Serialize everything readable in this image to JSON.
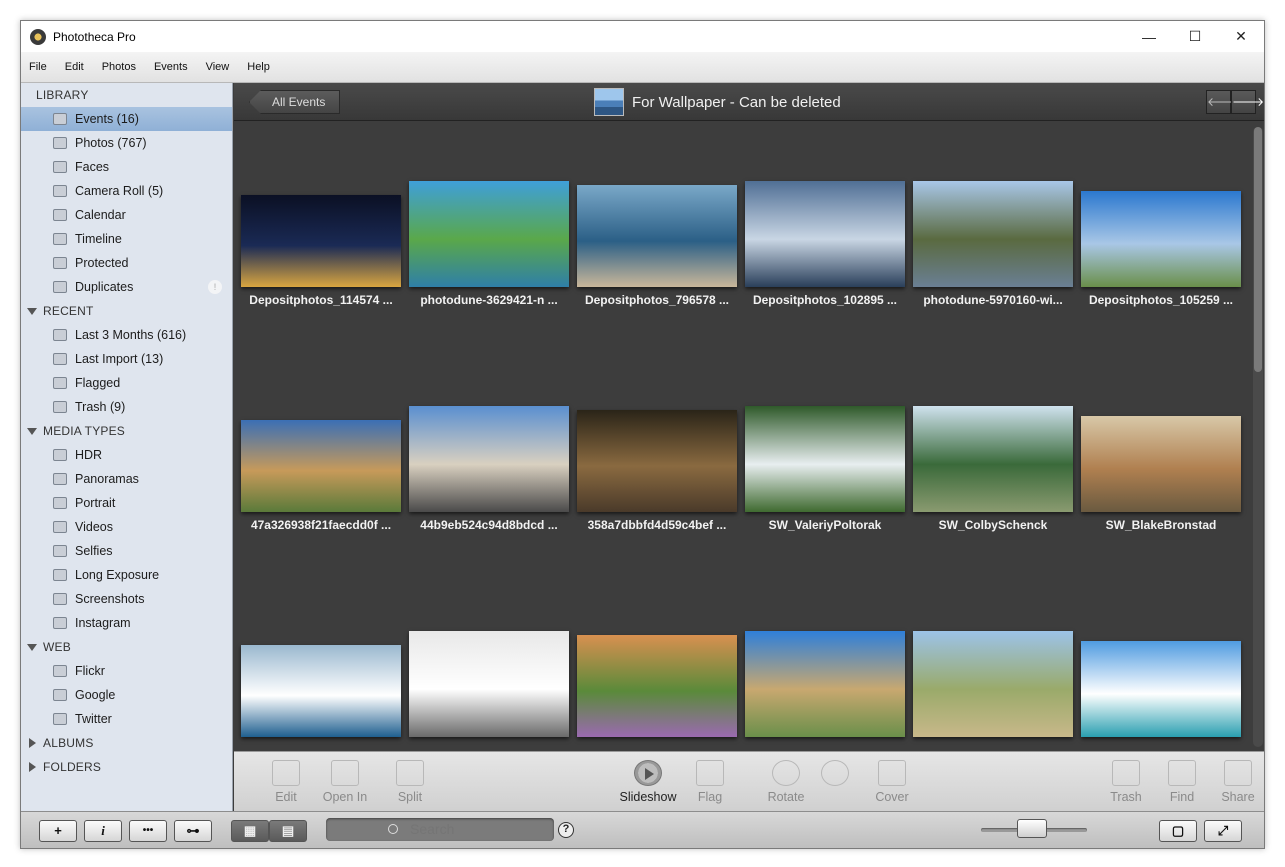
{
  "window": {
    "title": "Phototheca Pro",
    "controls": [
      "—",
      "☐",
      "✕"
    ]
  },
  "menu": [
    "File",
    "Edit",
    "Photos",
    "Events",
    "View",
    "Help"
  ],
  "sidebar": {
    "library_label": "LIBRARY",
    "library": [
      {
        "label": "Events (16)",
        "icon": "events-icon",
        "selected": true
      },
      {
        "label": "Photos (767)",
        "icon": "photos-icon"
      },
      {
        "label": "Faces",
        "icon": "faces-icon"
      },
      {
        "label": "Camera Roll (5)",
        "icon": "camera-roll-icon"
      },
      {
        "label": "Calendar",
        "icon": "calendar-icon"
      },
      {
        "label": "Timeline",
        "icon": "timeline-icon"
      },
      {
        "label": "Protected",
        "icon": "lock-icon"
      },
      {
        "label": "Duplicates",
        "icon": "duplicates-icon",
        "badge": "!"
      }
    ],
    "recent_label": "RECENT",
    "recent": [
      {
        "label": "Last 3 Months (616)",
        "icon": "clock-icon"
      },
      {
        "label": "Last Import (13)",
        "icon": "import-icon"
      },
      {
        "label": "Flagged",
        "icon": "flag-icon"
      },
      {
        "label": "Trash (9)",
        "icon": "trash-icon"
      }
    ],
    "media_label": "MEDIA TYPES",
    "media": [
      {
        "label": "HDR",
        "icon": "hdr-icon"
      },
      {
        "label": "Panoramas",
        "icon": "panorama-icon"
      },
      {
        "label": "Portrait",
        "icon": "portrait-icon"
      },
      {
        "label": "Videos",
        "icon": "video-icon"
      },
      {
        "label": "Selfies",
        "icon": "selfie-icon"
      },
      {
        "label": "Long Exposure",
        "icon": "long-exposure-icon"
      },
      {
        "label": "Screenshots",
        "icon": "screenshot-icon"
      },
      {
        "label": "Instagram",
        "icon": "instagram-icon"
      }
    ],
    "web_label": "WEB",
    "web": [
      {
        "label": "Flickr",
        "icon": "flickr-icon"
      },
      {
        "label": "Google",
        "icon": "google-icon"
      },
      {
        "label": "Twitter",
        "icon": "twitter-icon"
      }
    ],
    "albums_label": "ALBUMS",
    "folders_label": "FOLDERS"
  },
  "topbar": {
    "back_label": "All Events",
    "event_title": "For Wallpaper - Can be deleted",
    "prev": "🡐",
    "next": "🡒"
  },
  "photos": [
    {
      "name": "Depositphotos_114574 ...",
      "c1": "#0b1024",
      "c2": "#1a2a55",
      "c3": "#d9a640"
    },
    {
      "name": "photodune-3629421-n ...",
      "c1": "#3f9fd9",
      "c2": "#5aa84a",
      "c3": "#2f7fa8"
    },
    {
      "name": "Depositphotos_796578 ...",
      "c1": "#7aa8c8",
      "c2": "#2b5f86",
      "c3": "#c9b79a"
    },
    {
      "name": "Depositphotos_102895 ...",
      "c1": "#506f95",
      "c2": "#c9d6e4",
      "c3": "#2a3f5a"
    },
    {
      "name": "photodune-5970160-wi...",
      "c1": "#a9c7e8",
      "c2": "#5a6a40",
      "c3": "#6a7f94"
    },
    {
      "name": "Depositphotos_105259 ...",
      "c1": "#2b78cf",
      "c2": "#a9c7e6",
      "c3": "#6a8f4a"
    },
    {
      "name": "47a326938f21faecdd0f ...",
      "c1": "#3b6fb5",
      "c2": "#c79a5a",
      "c3": "#5a7a3a"
    },
    {
      "name": "44b9eb524c94d8bdcd ...",
      "c1": "#5a8fd0",
      "c2": "#d9d0c0",
      "c3": "#4a4a4a"
    },
    {
      "name": "358a7dbbfd4d59c4bef ...",
      "c1": "#2a2418",
      "c2": "#8a6a40",
      "c3": "#4a3a2a"
    },
    {
      "name": "SW_ValeriyPoltorak",
      "c1": "#2f5a2a",
      "c2": "#e8eef0",
      "c3": "#3f6a30"
    },
    {
      "name": "SW_ColbySchenck",
      "c1": "#cfe2ee",
      "c2": "#3a6a3a",
      "c3": "#8a9a70"
    },
    {
      "name": "SW_BlakeBronstad",
      "c1": "#d8c8a8",
      "c2": "#b08050",
      "c3": "#6a5a40"
    },
    {
      "name": "",
      "c1": "#9ab8cf",
      "c2": "#ffffff",
      "c3": "#1f5f8f"
    },
    {
      "name": "",
      "c1": "#e8e8e8",
      "c2": "#ffffff",
      "c3": "#6a6a6a"
    },
    {
      "name": "",
      "c1": "#d89050",
      "c2": "#5a8a3a",
      "c3": "#9a6ab0"
    },
    {
      "name": "",
      "c1": "#2f7fd9",
      "c2": "#c8a870",
      "c3": "#6a8f4a"
    },
    {
      "name": "",
      "c1": "#9cc3e8",
      "c2": "#9aaa6a",
      "c3": "#c8b88a"
    },
    {
      "name": "",
      "c1": "#4f9be0",
      "c2": "#ffffff",
      "c3": "#2a9fb0"
    }
  ],
  "toolbar": {
    "edit": "Edit",
    "open_in": "Open In",
    "split": "Split",
    "slideshow": "Slideshow",
    "flag": "Flag",
    "rotate": "Rotate",
    "cover": "Cover",
    "trash": "Trash",
    "find": "Find",
    "share": "Share"
  },
  "bottombar": {
    "add": "+",
    "info": "i",
    "more": "•••",
    "key": "⊶",
    "search_placeholder": "Search",
    "help": "?"
  }
}
